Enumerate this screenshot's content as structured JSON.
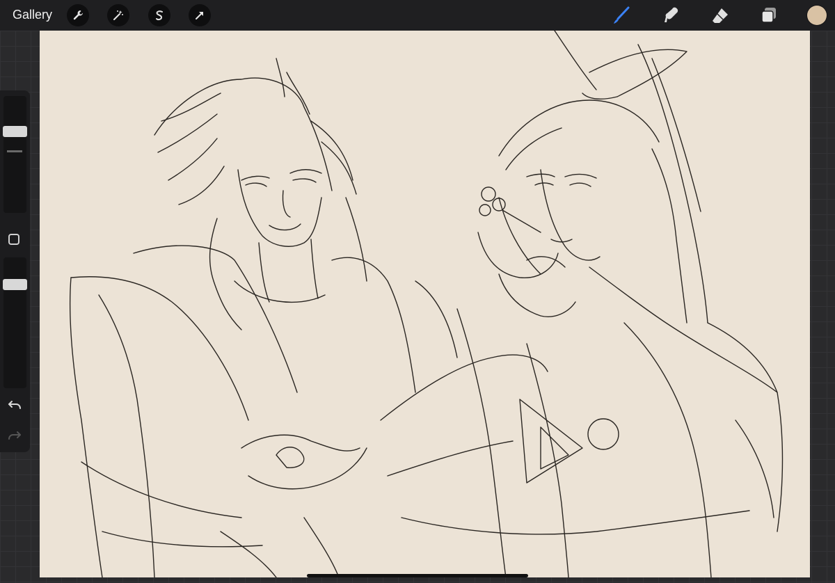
{
  "topbar": {
    "gallery_label": "Gallery",
    "left_tools": [
      "wrench-icon",
      "magic-wand-icon",
      "selection-icon",
      "transform-arrow-icon"
    ],
    "right_tools": [
      "brush-icon",
      "smudge-icon",
      "eraser-icon",
      "layers-icon"
    ],
    "active_tool": "brush-icon",
    "accent_color": "#3b82f6",
    "current_color": "#d9c2a4"
  },
  "canvas": {
    "background_color": "#ece3d6",
    "line_color": "#2a2622",
    "artwork": "line-art-sketch"
  },
  "sidebar": {
    "brush_size_level": 0.72,
    "opacity_level": 0.82,
    "tools": [
      "brush-size-slider",
      "modify-button",
      "opacity-slider",
      "undo-icon",
      "redo-icon"
    ]
  }
}
